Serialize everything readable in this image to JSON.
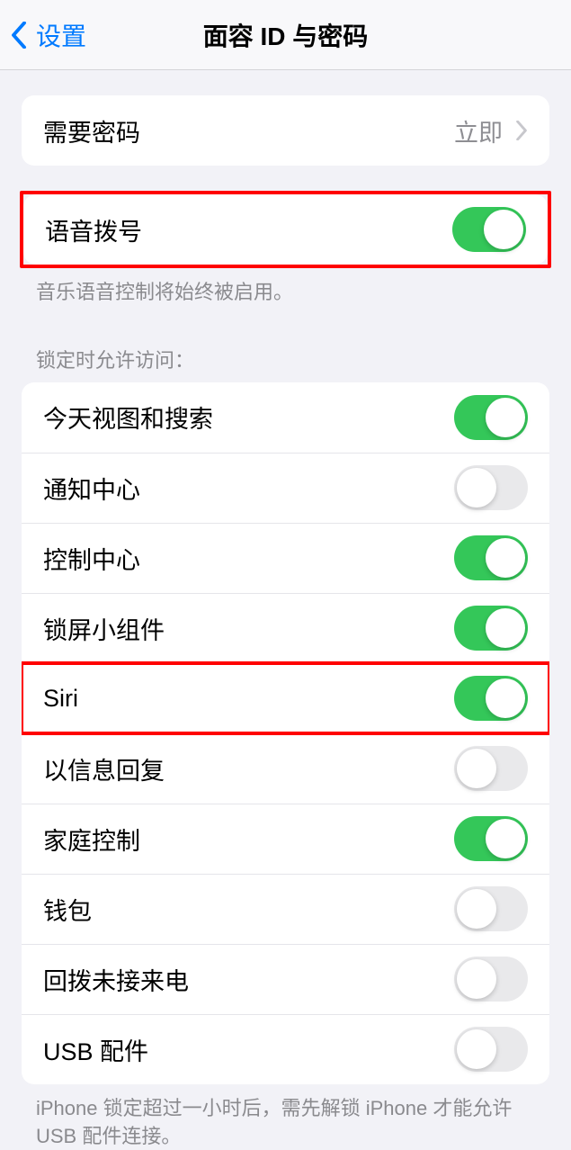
{
  "header": {
    "back_label": "设置",
    "title": "面容 ID 与密码"
  },
  "passcode_group": {
    "require_passcode": {
      "label": "需要密码",
      "value": "立即"
    }
  },
  "voice_dial": {
    "label": "语音拨号",
    "enabled": true,
    "footer": "音乐语音控制将始终被启用。"
  },
  "lock_access": {
    "header": "锁定时允许访问：",
    "items": [
      {
        "label": "今天视图和搜索",
        "enabled": true
      },
      {
        "label": "通知中心",
        "enabled": false
      },
      {
        "label": "控制中心",
        "enabled": true
      },
      {
        "label": "锁屏小组件",
        "enabled": true
      },
      {
        "label": "Siri",
        "enabled": true
      },
      {
        "label": "以信息回复",
        "enabled": false
      },
      {
        "label": "家庭控制",
        "enabled": true
      },
      {
        "label": "钱包",
        "enabled": false
      },
      {
        "label": "回拨未接来电",
        "enabled": false
      },
      {
        "label": "USB 配件",
        "enabled": false
      }
    ],
    "footer": "iPhone 锁定超过一小时后，需先解锁 iPhone 才能允许 USB 配件连接。"
  },
  "highlighted_rows": [
    0,
    5
  ]
}
